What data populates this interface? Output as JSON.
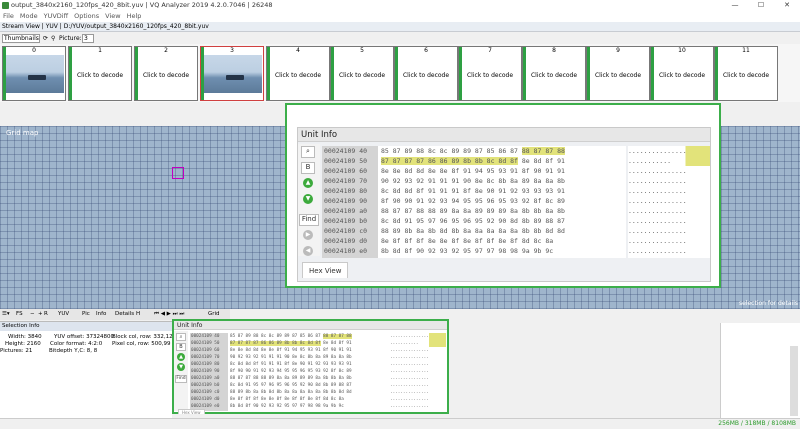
{
  "window": {
    "title": "output_3840x2160_120fps_420_8bit.yuv | VQ Analyzer 2019 4.2.0.7046 | 26248",
    "min": "—",
    "max": "☐",
    "close": "✕"
  },
  "menu": [
    "File",
    "Mode",
    "YUVDiff",
    "Options",
    "View",
    "Help"
  ],
  "stream_view": {
    "label": "Stream View",
    "path": "YUV | D:/YUV/output_3840x2160_120fps_420_8bit.yuv"
  },
  "thumb_bar": {
    "mode": "Thumbnails",
    "picture_label": "Picture:",
    "picture_value": "3"
  },
  "frames": [
    {
      "n": "0",
      "text": "",
      "thumb": true
    },
    {
      "n": "1",
      "text": "Click to decode",
      "thumb": false
    },
    {
      "n": "2",
      "text": "Click to decode",
      "thumb": false
    },
    {
      "n": "3",
      "text": "",
      "thumb": true
    },
    {
      "n": "4",
      "text": "Click to decode",
      "thumb": false
    },
    {
      "n": "5",
      "text": "Click to decode",
      "thumb": false
    },
    {
      "n": "6",
      "text": "Click to decode",
      "thumb": false
    },
    {
      "n": "7",
      "text": "Click to decode",
      "thumb": false
    },
    {
      "n": "8",
      "text": "Click to decode",
      "thumb": false
    },
    {
      "n": "9",
      "text": "Click to decode",
      "thumb": false
    },
    {
      "n": "10",
      "text": "Click to decode",
      "thumb": false
    },
    {
      "n": "11",
      "text": "Click to decode",
      "thumb": false
    }
  ],
  "grid": {
    "label": "Grid map",
    "hint": "selection for details"
  },
  "grid_toolbar": {
    "fs": "FS",
    "yuv": "YUV",
    "pic": "Pic",
    "info": "Info",
    "details": "Details",
    "h": "H",
    "grid": "Grid"
  },
  "selection_info": {
    "header": "Selection Info",
    "width_label": "Width:",
    "width": "3840",
    "height_label": "Height:",
    "height": "2160",
    "pictures_label": "Pictures:",
    "pictures": "21",
    "yuv_offset_label": "YUV offset:",
    "yuv_offset": "37324800",
    "color_format_label": "Color format:",
    "color_format": "4:2:0",
    "bitdepth_label": "Bitdepth Y,C:",
    "bitdepth": "8, 8",
    "block_col_label": "Block col, row:",
    "block_col": "332,128",
    "pixel_col_label": "Pixel col, row:",
    "pixel_col": "500,99"
  },
  "unit_info": {
    "title": "Unit Info",
    "tab": "Hex View",
    "buttons": {
      "b": "B",
      "find": "Find"
    },
    "addresses": [
      "00024109 40",
      "00024109 50",
      "00024109 60",
      "00024109 70",
      "00024109 80",
      "00024109 90",
      "00024109 a0",
      "00024109 b0",
      "00024109 c0",
      "00024109 d0",
      "00024109 e0"
    ],
    "rows": [
      {
        "pre": "85 87 89 88 8c 8c 89 89 87 85 86 87 ",
        "hl": "88 87 87 88",
        "post": ""
      },
      {
        "pre": "",
        "hl": "87 87 87 87 86 86 89 8b 8b 8c 8d 8f",
        "post": " 8e 8d 8f 91"
      },
      {
        "pre": "8e 8e 8d 8d 8e 8e 8f 91 94 95 93 91 8f 90 91 91",
        "hl": "",
        "post": ""
      },
      {
        "pre": "90 92 93 92 91 91 91 90 8e 8c 8b 8a 89 8a 8a 8b",
        "hl": "",
        "post": ""
      },
      {
        "pre": "8c 8d 8d 8f 91 91 91 8f 8e 90 91 92 93 93 93 91",
        "hl": "",
        "post": ""
      },
      {
        "pre": "8f 90 90 91 92 93 94 95 95 96 95 93 92 8f 8c 89",
        "hl": "",
        "post": ""
      },
      {
        "pre": "88 87 87 88 88 89 8a 8a 89 89 89 8a 8b 8b 8a 8b",
        "hl": "",
        "post": ""
      },
      {
        "pre": "8c 8d 91 95 97 96 95 96 95 92 90 8d 8b 89 88 87",
        "hl": "",
        "post": ""
      },
      {
        "pre": "88 89 8b 8a 8b 8d 8b 8a 8a 8a 8a 8a 8b 8b 8d 8d",
        "hl": "",
        "post": ""
      },
      {
        "pre": "8e 8f 8f 8f 8e 8e 8f 8e 8f 8f 8e 8f 8d 8c 8a",
        "hl": "",
        "post": ""
      },
      {
        "pre": "8b 8d 8f 90 92 93 92 95 97 97 98 98 9a 9b 9c",
        "hl": "",
        "post": ""
      }
    ],
    "ascii": [
      "...............",
      "...........",
      "...............",
      "...............",
      "...............",
      "...............",
      "...............",
      "...............",
      "...............",
      "...............",
      "..............."
    ]
  },
  "memory": "256MB / 318MB / 8108MB",
  "colors": {
    "highlight_green": "#3cae4a",
    "hex_highlight": "#e2e37a",
    "selection": "#c000c0"
  }
}
